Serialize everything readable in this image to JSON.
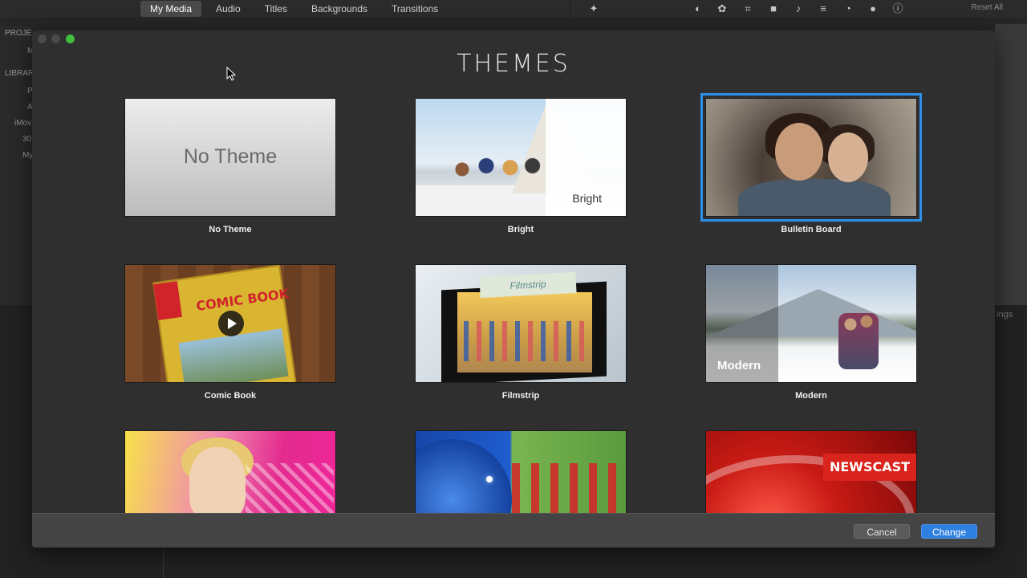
{
  "app": {
    "tabs": [
      "My Media",
      "Audio",
      "Titles",
      "Backgrounds",
      "Transitions"
    ],
    "active_tab": "My Media",
    "reset_all": "Reset All",
    "sidebar": {
      "projects_heading": "PROJE",
      "project_item": "M",
      "libraries_heading": "LIBRAR",
      "photos_item": "P",
      "app_item": "A",
      "library_item": "iMov",
      "event1": "30",
      "event2": "My"
    },
    "settings_fragment": "ings"
  },
  "modal": {
    "title": "THEMES",
    "themes": [
      {
        "label": "No Theme",
        "thumb_text": "No Theme",
        "selected": false
      },
      {
        "label": "Bright",
        "thumb_text": "Bright",
        "selected": false
      },
      {
        "label": "Bulletin Board",
        "thumb_text": "",
        "selected": true
      },
      {
        "label": "Comic Book",
        "thumb_text": "COMIC BOOK",
        "selected": false
      },
      {
        "label": "Filmstrip",
        "thumb_text": "Filmstrip",
        "selected": false
      },
      {
        "label": "Modern",
        "thumb_text": "Modern",
        "selected": false
      },
      {
        "label": "",
        "thumb_text": "",
        "selected": false
      },
      {
        "label": "",
        "thumb_text": "",
        "selected": false
      },
      {
        "label": "",
        "thumb_text": "NEWSCAST",
        "selected": false
      }
    ],
    "cancel_label": "Cancel",
    "change_label": "Change"
  },
  "colors": {
    "accent": "#2d7fe0",
    "selection": "#2f8fe8",
    "zoom_button": "#3fbf3f"
  }
}
